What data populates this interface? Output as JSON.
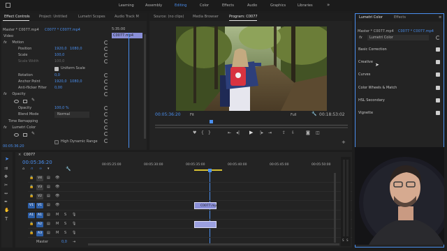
{
  "workspace": {
    "tabs": [
      "Learning",
      "Assembly",
      "Editing",
      "Color",
      "Effects",
      "Audio",
      "Graphics",
      "Libraries"
    ],
    "active": "Editing"
  },
  "effect_controls": {
    "tabs": [
      "Effect Controls",
      "Project: Untitled",
      "Lumetri Scopes",
      "Audio Track M"
    ],
    "master_label": "Master * C0077.mp4",
    "clip_label": "C0077 * C0077.mp4",
    "timecode_top": "5:35:00",
    "clip_chip": "C0077.mp4",
    "video_header": "Video",
    "motion": "Motion",
    "position_label": "Position",
    "position_x": "1920,0",
    "position_y": "1080,0",
    "scale_label": "Scale",
    "scale_value": "100,0",
    "scale_width_label": "Scale Width",
    "scale_width_value": "100,0",
    "uniform_scale": "Uniform Scale",
    "rotation_label": "Rotation",
    "rotation_value": "0,0",
    "anchor_label": "Anchor Point",
    "anchor_x": "1920,0",
    "anchor_y": "1080,0",
    "antiflicker_label": "Anti-flicker Filter",
    "antiflicker_value": "0,00",
    "opacity": "Opacity",
    "opacity_label": "Opacity",
    "opacity_value": "100,0 %",
    "blend_label": "Blend Mode",
    "blend_value": "Normal",
    "time_remap": "Time Remapping",
    "lumetri": "Lumetri Color",
    "high_dynamic": "High Dynamic Range",
    "bottom_timecode": "00:05:36:20"
  },
  "program": {
    "tabs": [
      "Source: (no clips)",
      "Media Browser",
      "Program: C0077"
    ],
    "timecode": "00:05:36:20",
    "fit": "Fit",
    "full": "Full",
    "duration": "00:18:53:02"
  },
  "timeline": {
    "tab_label": "C0077",
    "timecode": "00:05:36:20",
    "ruler": [
      "00:05:25:00",
      "00:05:30:00",
      "00:05:35:00",
      "00:05:40:00",
      "00:05:45:00",
      "00:05:50:00"
    ],
    "tracks": [
      {
        "name": "V4",
        "kind": "video"
      },
      {
        "name": "V3",
        "kind": "video"
      },
      {
        "name": "V2",
        "kind": "video"
      },
      {
        "name": "V1",
        "kind": "video"
      },
      {
        "name": "A1",
        "kind": "audio"
      },
      {
        "name": "A2",
        "kind": "audio"
      },
      {
        "name": "A3",
        "kind": "audio"
      }
    ],
    "v1_source": "V1",
    "a1_source": "A1",
    "clip_v1": "C0077.mp4",
    "master_label": "Master",
    "master_value": "0,0",
    "meter_labels": [
      "S",
      "S"
    ]
  },
  "lumetri_panel": {
    "tabs": [
      "Lumetri Color",
      "Effects"
    ],
    "master_label": "Master * C0077.mp4",
    "clip_label": "C0077 * C0077.mp4",
    "fx_label": "fx",
    "effect_name": "Lumetri Color",
    "sections": [
      "Basic Correction",
      "Creative",
      "Curves",
      "Color Wheels & Match",
      "HSL Secondary",
      "Vignette"
    ]
  },
  "colors": {
    "accent_blue": "#4a8ff0",
    "playhead": "#4a8ff0",
    "panel_bg": "#232323",
    "app_bg": "#1d1d1d",
    "active_tab": "#e6e6e6",
    "clip_video": "#8a8fd8",
    "clip_audio": "#9ba0e0"
  }
}
